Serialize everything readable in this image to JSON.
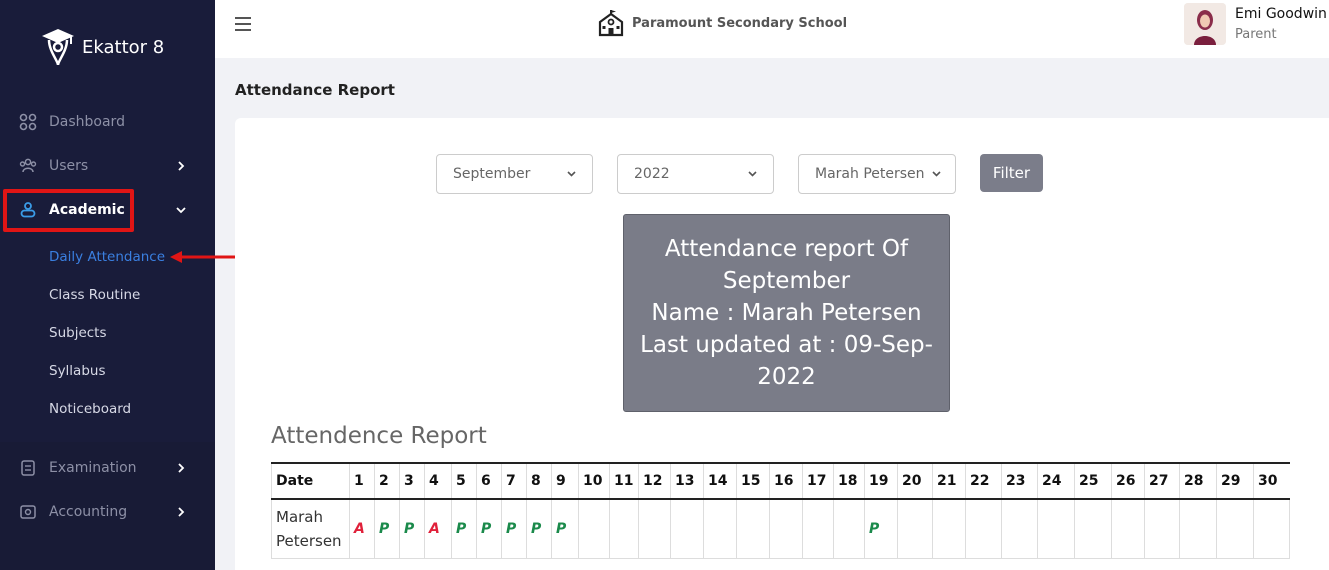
{
  "app": {
    "name": "Ekattor 8"
  },
  "sidebar": {
    "items": [
      {
        "label": "Dashboard",
        "icon": "dashboard-icon"
      },
      {
        "label": "Users",
        "icon": "users-icon"
      },
      {
        "label": "Academic",
        "icon": "academic-icon"
      },
      {
        "label": "Examination",
        "icon": "examination-icon"
      },
      {
        "label": "Accounting",
        "icon": "accounting-icon"
      }
    ],
    "academic_sub": [
      "Daily Attendance",
      "Class Routine",
      "Subjects",
      "Syllabus",
      "Noticeboard"
    ]
  },
  "header": {
    "school_name": "Paramount Secondary School",
    "user_name": "Emi Goodwin",
    "user_role": "Parent"
  },
  "page": {
    "title": "Attendance Report"
  },
  "filters": {
    "month": "September",
    "year": "2022",
    "student": "Marah Petersen",
    "filter_label": "Filter"
  },
  "info": {
    "line1": "Attendance report Of",
    "line2": "September",
    "line3": "Name : Marah Petersen",
    "line4": "Last updated at : 09-Sep-",
    "line5": "2022"
  },
  "report": {
    "title": "Attendence Report",
    "date_header": "Date",
    "days": [
      "1",
      "2",
      "3",
      "4",
      "5",
      "6",
      "7",
      "8",
      "9",
      "10",
      "11",
      "12",
      "13",
      "14",
      "15",
      "16",
      "17",
      "18",
      "19",
      "20",
      "21",
      "22",
      "23",
      "24",
      "25",
      "26",
      "27",
      "28",
      "29",
      "30"
    ],
    "rows": [
      {
        "name_line1": "Marah",
        "name_line2": "Petersen",
        "marks": [
          "A",
          "P",
          "P",
          "A",
          "P",
          "P",
          "P",
          "P",
          "P",
          "",
          "",
          "",
          "",
          "",
          "",
          "",
          "",
          "",
          "P",
          "",
          "",
          "",
          "",
          "",
          "",
          "",
          "",
          "",
          "",
          ""
        ]
      }
    ]
  },
  "colors": {
    "sidebar": "#191c3a",
    "highlight": "#e01515",
    "present": "#1b8a4b",
    "absent": "#e0203a",
    "link": "#3a7fe0"
  }
}
